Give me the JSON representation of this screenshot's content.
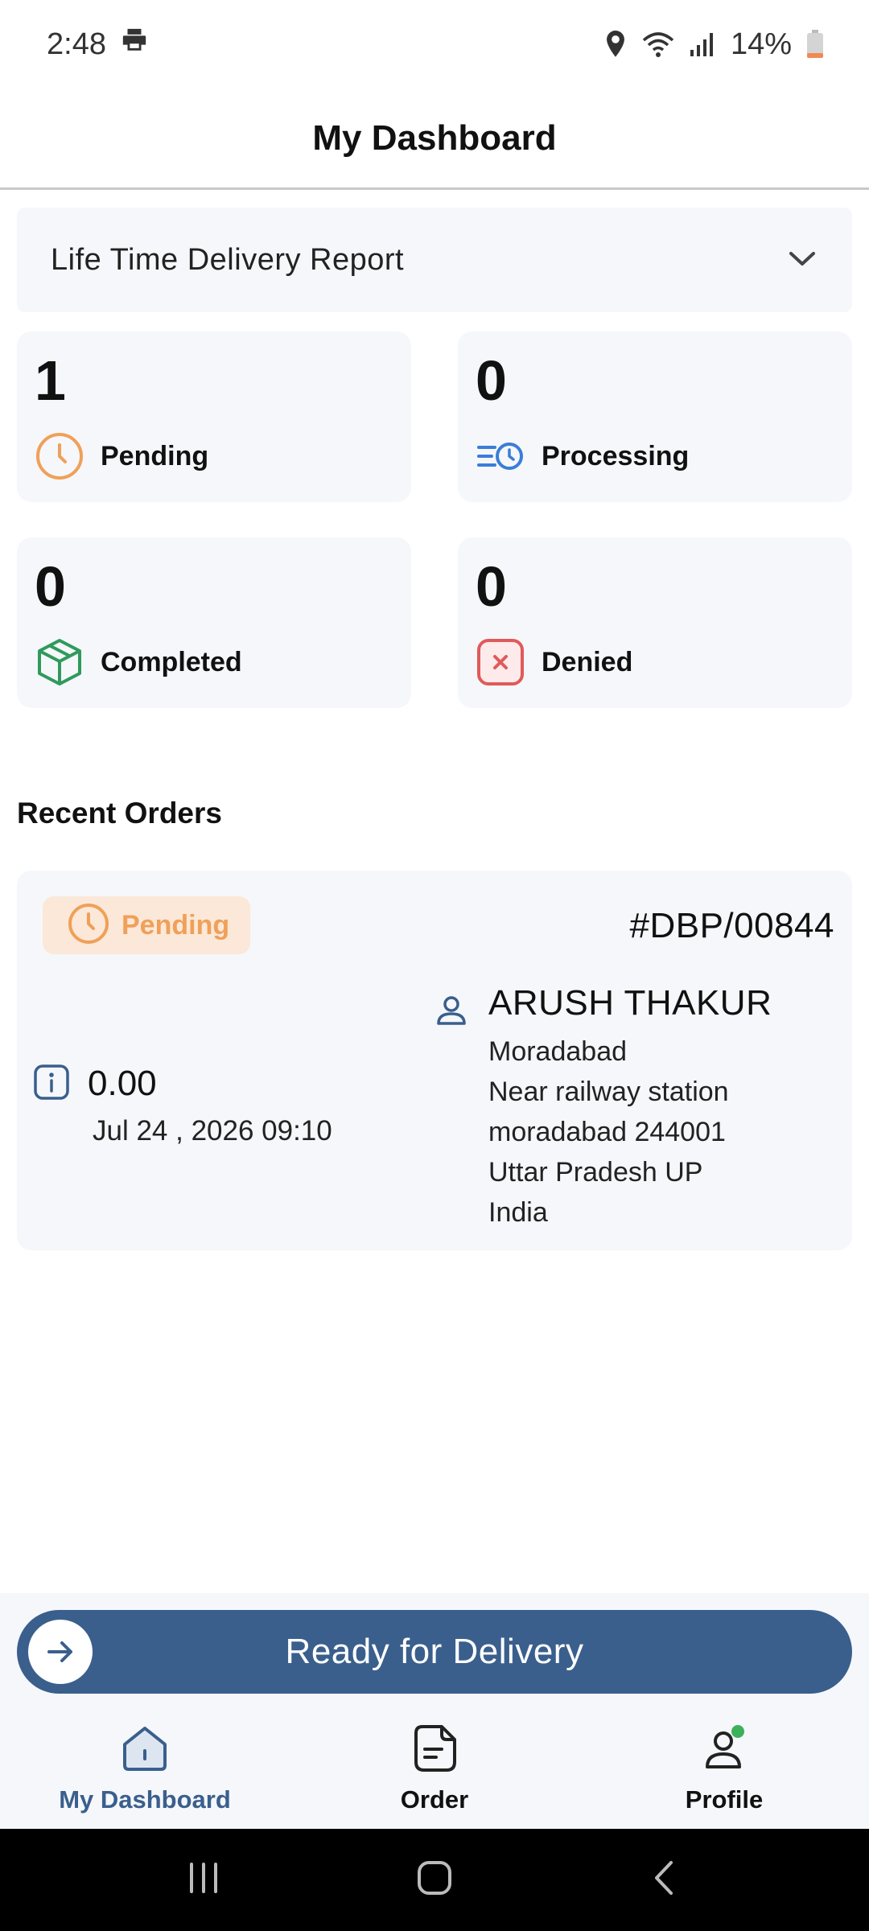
{
  "status_bar": {
    "time": "2:48",
    "battery": "14%"
  },
  "header": {
    "title": "My Dashboard"
  },
  "report_select": {
    "label": "Life Time Delivery Report"
  },
  "stats": {
    "pending": {
      "count": "1",
      "label": "Pending",
      "icon": "clock-icon",
      "color": "#f0a058"
    },
    "processing": {
      "count": "0",
      "label": "Processing",
      "icon": "list-clock-icon",
      "color": "#3b7dd8"
    },
    "completed": {
      "count": "0",
      "label": "Completed",
      "icon": "box-icon",
      "color": "#2f9a5c"
    },
    "denied": {
      "count": "0",
      "label": "Denied",
      "icon": "x-square-icon",
      "color": "#e05a5a"
    }
  },
  "recent_orders": {
    "title": "Recent Orders",
    "orders": [
      {
        "status": "Pending",
        "order_id": "#DBP/00844",
        "amount": "0.00",
        "date": "Jul 24 , 2026 09:10",
        "customer_name": "ARUSH THAKUR",
        "address_lines": [
          "Moradabad",
          "Near railway station",
          "moradabad 244001",
          "Uttar Pradesh UP",
          "India"
        ]
      }
    ]
  },
  "action": {
    "ready_label": "Ready for Delivery"
  },
  "bottom_nav": {
    "items": [
      {
        "label": "My Dashboard",
        "icon": "home-icon",
        "active": true
      },
      {
        "label": "Order",
        "icon": "document-icon",
        "active": false
      },
      {
        "label": "Profile",
        "icon": "person-icon",
        "active": false
      }
    ]
  },
  "colors": {
    "primary": "#3a5f8d",
    "card_bg": "#f5f7fa",
    "pending_accent": "#f0a058",
    "online_dot": "#3db05a"
  }
}
